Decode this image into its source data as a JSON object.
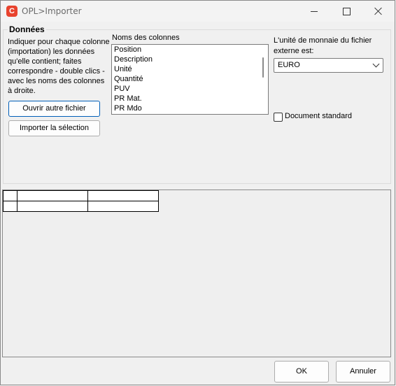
{
  "window": {
    "title": "OPL>Importer",
    "app_icon_letter": "C"
  },
  "group": {
    "title": "Données",
    "instructions": "Indiquer pour chaque colonne (importation) les données qu'elle contient; faites correspondre - double clics - avec les noms des colonnes à droite.",
    "open_button": "Ouvrir autre fichier",
    "import_button": "Importer la sélection"
  },
  "columns": {
    "label": "Noms des colonnes",
    "items": [
      "Position",
      "Description",
      "Unité",
      "Quantité",
      "PUV",
      "PR Mat.",
      "PR Mdo"
    ]
  },
  "currency": {
    "label": "L'unité de monnaie du fichier externe est:",
    "selected": "EURO"
  },
  "standard_doc": {
    "label": "Document standard",
    "checked": false
  },
  "buttons": {
    "ok": "OK",
    "cancel": "Annuler"
  }
}
